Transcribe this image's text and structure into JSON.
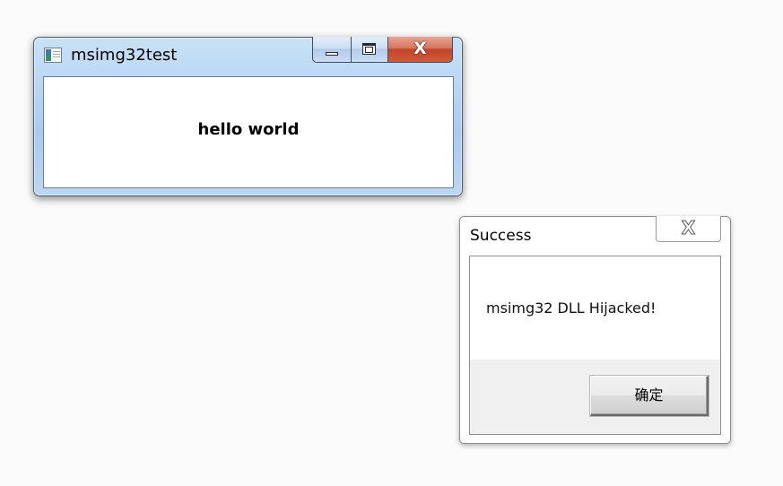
{
  "main_window": {
    "title": "msimg32test",
    "client_text": "hello world",
    "caption_buttons": {
      "minimize_icon": "minimize-icon",
      "maximize_icon": "maximize-icon",
      "close_icon": "close-icon",
      "close_glyph": "X"
    },
    "colors": {
      "frame": "#b7d5f4",
      "close_button": "#c2442a"
    }
  },
  "message_box": {
    "title": "Success",
    "message": "msimg32 DLL Hijacked!",
    "ok_label": "确定",
    "close_glyph": "X",
    "colors": {
      "footer": "#f0f0f0"
    }
  }
}
